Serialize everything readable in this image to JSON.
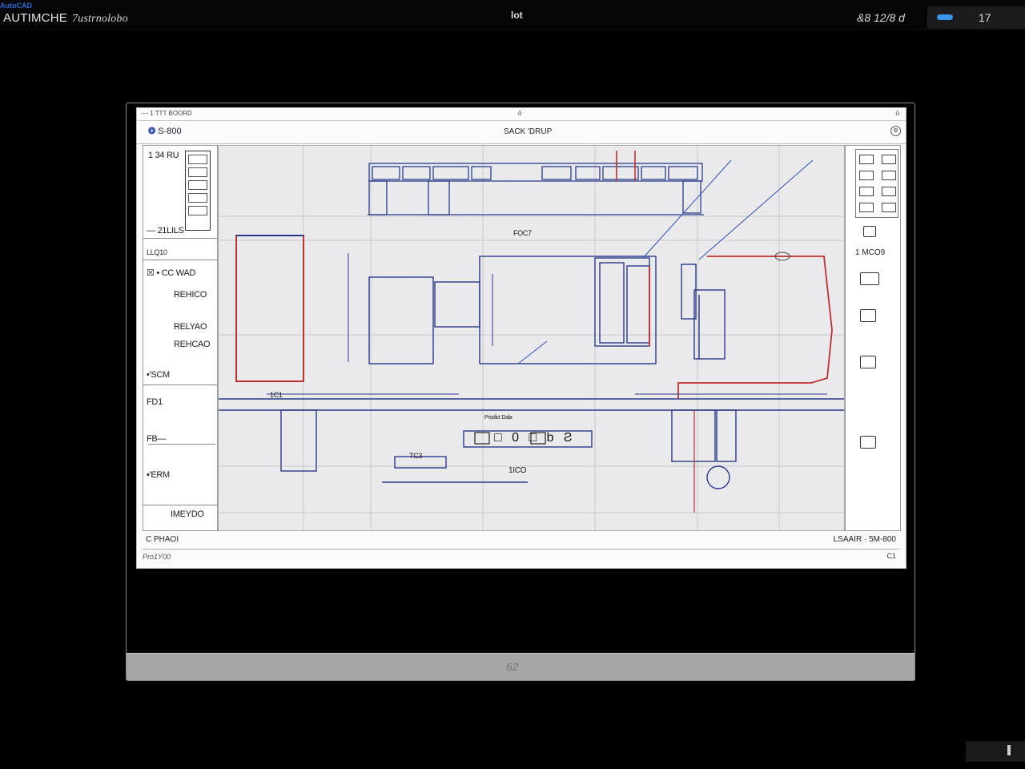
{
  "topbar": {
    "badge": "AutoCAD",
    "app_title": "AUTIMCHE",
    "app_subtitle": "7ustrnolobo",
    "center_glyph": "lot",
    "status": "&8 12/8 d",
    "right_label": "17"
  },
  "cad": {
    "top_left": "— 1 TTT BOORD",
    "top_center": "ō",
    "top_right": "ō",
    "logo": "S-800",
    "title": "SACK 'DRUP",
    "left_panel": {
      "header": "1 34 RU",
      "label_1": "— 21LILS",
      "label_2": "LLQ10",
      "label_3": "☒ • CC WAD",
      "label_4": "REHICO",
      "label_5": "RELYAO",
      "label_6": "REHCAO",
      "label_7": "•'SCM",
      "label_8": "FD1",
      "label_9": "FB—",
      "label_10": "•'ERM",
      "label_11": "IMEYDO"
    },
    "canvas": {
      "dim_1": "FOC7",
      "dim_2": "1C1",
      "dim_3": "TC3",
      "dim_4": "Prodict Dala",
      "dim_5": "1ICO",
      "block_text": "□ 0 □ b Ƨ"
    },
    "right_panel": {
      "label": "1 MCO9"
    },
    "status_left": "C PHAOI",
    "status_right": "LSAAIR · 5M-800",
    "cmd_left": "Pro1Y00",
    "cmd_right": "C1"
  },
  "frame_footer": "62"
}
